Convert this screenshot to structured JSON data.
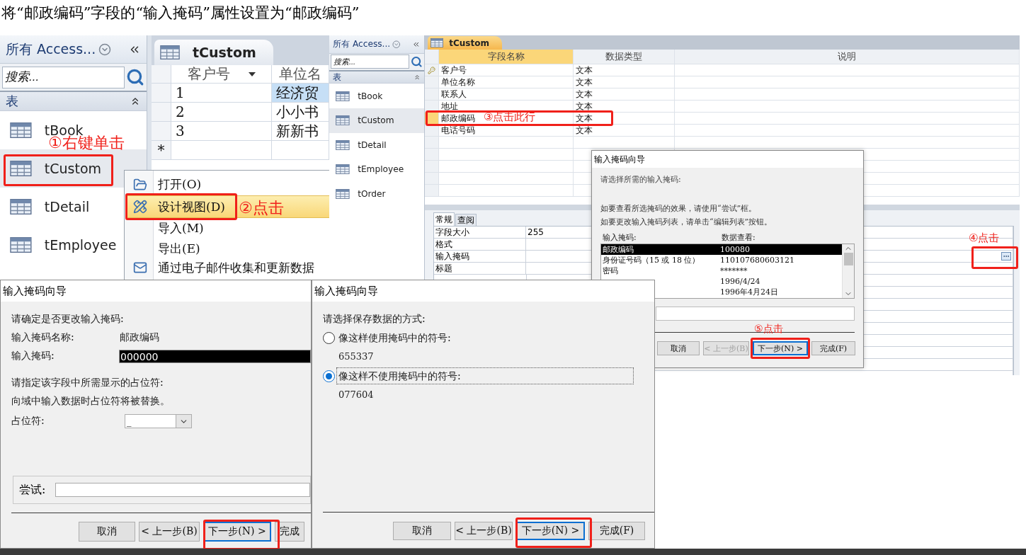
{
  "instruction": "将“邮政编码”字段的“输入掩码”属性设置为“邮政编码”",
  "nav_panes": [
    {
      "title": "所有 Access...",
      "search_placeholder": "搜索...",
      "group": "表",
      "items": [
        {
          "label": "tBook",
          "selected": false
        },
        {
          "label": "tCustom",
          "selected": true
        },
        {
          "label": "tDetail",
          "selected": false
        },
        {
          "label": "tEmployee",
          "selected": false
        }
      ]
    },
    {
      "title": "所有 Access...",
      "search_placeholder": "搜索...",
      "group": "表",
      "items": [
        {
          "label": "tBook",
          "selected": false
        },
        {
          "label": "tCustom",
          "selected": true
        },
        {
          "label": "tDetail",
          "selected": false
        },
        {
          "label": "tEmployee",
          "selected": false
        },
        {
          "label": "tOrder",
          "selected": false
        }
      ]
    }
  ],
  "datasheet": {
    "tab": "tCustom",
    "columns": [
      "客户号",
      "单位名"
    ],
    "rows": [
      {
        "cells": [
          "1",
          "经济贸"
        ],
        "focused": true
      },
      {
        "cells": [
          "2",
          "小小书"
        ],
        "focused": false
      },
      {
        "cells": [
          "3",
          "新新书"
        ],
        "focused": false
      }
    ],
    "new_row_marker": "*"
  },
  "context_menu": [
    {
      "label": "打开(O)",
      "selected": false
    },
    {
      "label": "设计视图(D)",
      "selected": true
    },
    {
      "label": "导入(M)",
      "selected": false
    },
    {
      "label": "导出(E)",
      "selected": false
    },
    {
      "label": "通过电子邮件收集和更新数据",
      "selected": false
    }
  ],
  "design_view": {
    "tab": "tCustom",
    "columns": [
      {
        "label": "字段名称",
        "selected": true
      },
      {
        "label": "数据类型",
        "selected": false
      },
      {
        "label": "说明",
        "selected": false
      }
    ],
    "fields": [
      {
        "name": "客户号",
        "type": "文本",
        "primary_key": true,
        "selected": false
      },
      {
        "name": "单位名称",
        "type": "文本",
        "primary_key": false,
        "selected": false
      },
      {
        "name": "联系人",
        "type": "文本",
        "primary_key": false,
        "selected": false
      },
      {
        "name": "地址",
        "type": "文本",
        "primary_key": false,
        "selected": false
      },
      {
        "name": "邮政编码",
        "type": "文本",
        "primary_key": false,
        "selected": true
      },
      {
        "name": "电话号码",
        "type": "文本",
        "primary_key": false,
        "selected": false
      }
    ],
    "property_tabs": [
      {
        "label": "常规",
        "selected": true
      },
      {
        "label": "查阅",
        "selected": false
      }
    ],
    "properties": [
      {
        "name": "字段大小",
        "value": "255"
      },
      {
        "name": "格式"
      },
      {
        "name": "输入掩码",
        "builder": true
      },
      {
        "name": "标题"
      }
    ]
  },
  "mask_wizard": {
    "title": "输入掩码向导",
    "prompt": "请选择所需的输入掩码:",
    "hints": [
      "如要查看所选掩码的效果，请使用“尝试”框。",
      "如要更改输入掩码列表，请单击“编辑列表”按钮。"
    ],
    "list_headers": [
      "输入掩码:",
      "数据查看:"
    ],
    "masks": [
      {
        "name": "邮政编码",
        "sample": "100080",
        "selected": true
      },
      {
        "name": "身份证号码（15 或 18 位）",
        "sample": "110107680603121",
        "selected": false
      },
      {
        "name": "密码",
        "sample": "*******",
        "selected": false
      },
      {
        "sample": "1996/4/24",
        "selected": false
      },
      {
        "sample": "1996年4月24日",
        "selected": false
      }
    ],
    "buttons": [
      {
        "label": "取消",
        "disabled": false,
        "default": false
      },
      {
        "label": "< 上一步(B)",
        "disabled": true,
        "default": false
      },
      {
        "label": "下一步(N) >",
        "disabled": false,
        "default": true
      },
      {
        "label": "完成(F)",
        "disabled": false,
        "default": false
      }
    ]
  },
  "confirm_wizard": {
    "title": "输入掩码向导",
    "prompt": "请确定是否更改输入掩码:",
    "mask_name_label": "输入掩码名称:",
    "mask_name": "邮政编码",
    "mask_label": "输入掩码:",
    "mask": "000000",
    "mask_highlighted": true,
    "placeholder_hints": [
      "请指定该字段中所需显示的占位符:",
      "向域中输入数据时占位符将被替换。"
    ],
    "placeholder_label": "占位符:",
    "placeholder_char": "_",
    "try_label": "尝试:",
    "buttons": [
      {
        "label": "取消",
        "disabled": false,
        "default": false
      },
      {
        "label": "< 上一步(B)",
        "disabled": false,
        "default": false
      },
      {
        "label": "下一步(N) >",
        "disabled": false,
        "default": true
      },
      {
        "label": "完成",
        "disabled": false,
        "default": false
      }
    ]
  },
  "storage_wizard": {
    "title": "输入掩码向导",
    "prompt": "请选择保存数据的方式:",
    "options": [
      {
        "label": "像这样使用掩码中的符号:",
        "sample": "655337",
        "selected": false
      },
      {
        "label": "像这样不使用掩码中的符号:",
        "sample": "077604",
        "selected": true
      }
    ],
    "buttons": [
      {
        "label": "取消",
        "disabled": false,
        "default": false
      },
      {
        "label": "< 上一步(B)",
        "disabled": false,
        "default": false
      },
      {
        "label": "下一步(N) >",
        "disabled": false,
        "default": true
      },
      {
        "label": "完成(F)",
        "disabled": false,
        "default": false
      }
    ]
  },
  "annotations": [
    "①右键单击",
    "②点击",
    "③点击此行",
    "④点击",
    "⑤点击"
  ]
}
